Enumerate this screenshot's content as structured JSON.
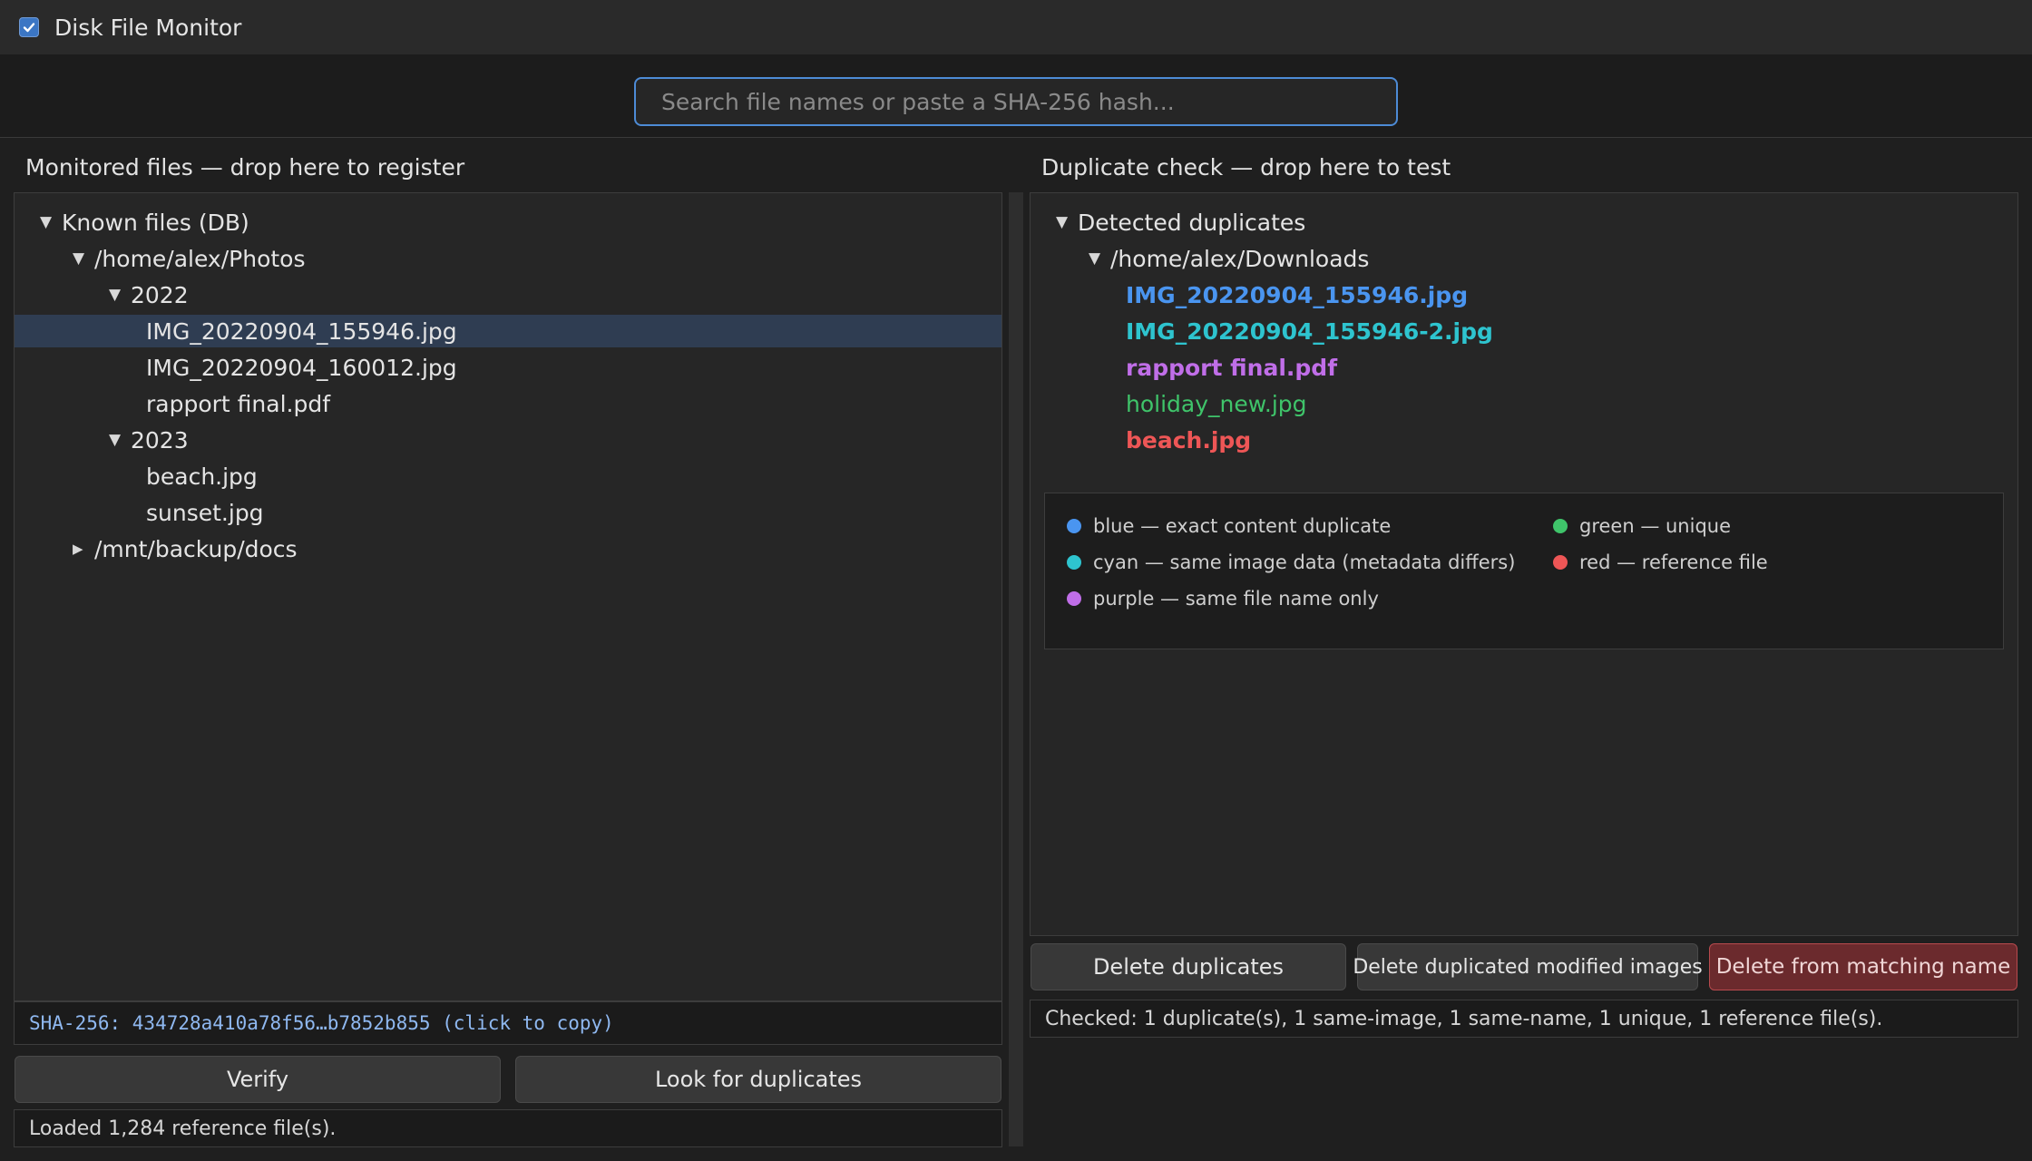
{
  "app": {
    "title": "Disk File Monitor"
  },
  "search": {
    "placeholder": "Search file names or paste a SHA-256 hash..."
  },
  "left": {
    "title": "Monitored files — drop here to register",
    "tree": {
      "root": "Known files (DB)",
      "folder1": "/home/alex/Photos",
      "year2022": "2022",
      "file1": "IMG_20220904_155946.jpg",
      "file2": "IMG_20220904_160012.jpg",
      "file3": "rapport final.pdf",
      "year2023": "2023",
      "file4": "beach.jpg",
      "file5": "sunset.jpg",
      "folder2": "/mnt/backup/docs"
    },
    "hash": "SHA-256: 434728a410a78f56…b7852b855 (click to copy)",
    "verify_label": "Verify",
    "look_label": "Look for duplicates",
    "status": "Loaded 1,284 reference file(s)."
  },
  "right": {
    "title": "Duplicate check — drop here to test",
    "tree": {
      "root": "Detected duplicates",
      "folder": "/home/alex/Downloads",
      "files": [
        {
          "name": "IMG_20220904_155946.jpg",
          "color": "#4a95f0"
        },
        {
          "name": "IMG_20220904_155946-2.jpg",
          "color": "#2ec4cf"
        },
        {
          "name": "rapport final.pdf",
          "color": "#c06ee8"
        },
        {
          "name": "holiday_new.jpg",
          "color": "#3fc46a"
        },
        {
          "name": "beach.jpg",
          "color": "#ee5656"
        }
      ]
    },
    "legend": {
      "blue": {
        "text": "blue — exact content duplicate",
        "color": "#4a95f0"
      },
      "cyan": {
        "text": "cyan — same image data (metadata differs)",
        "color": "#2ec4cf"
      },
      "purple": {
        "text": "purple — same file name only",
        "color": "#c06ee8"
      },
      "green": {
        "text": "green — unique",
        "color": "#3fc46a"
      },
      "red": {
        "text": "red — reference file",
        "color": "#ee5656"
      }
    },
    "delete_dup_label": "Delete duplicates",
    "delete_mod_label": "Delete duplicated modified images",
    "delete_name_label": "Delete from matching name",
    "status": "Checked: 1 duplicate(s), 1 same-image, 1 same-name, 1 unique, 1 reference file(s)."
  }
}
